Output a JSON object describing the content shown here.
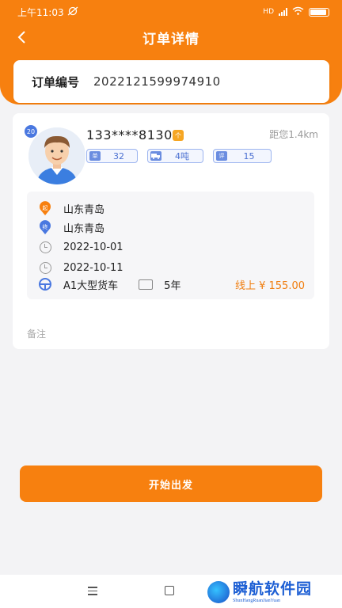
{
  "status_bar": {
    "time": "上午11:03",
    "signal_label": "HD"
  },
  "navbar": {
    "title": "订单详情"
  },
  "order": {
    "label": "订单编号",
    "number": "2022121599974910"
  },
  "driver": {
    "age_badge": "20",
    "phone": "133****8130",
    "vip_badge": "个",
    "distance": "距您1.4km",
    "tags": [
      {
        "icon_text": "单",
        "value": "32"
      },
      {
        "icon_text": "车",
        "value": "4吨"
      },
      {
        "icon_text": "评",
        "value": "15"
      }
    ]
  },
  "route": {
    "start_badge": "起",
    "end_badge": "终",
    "start": "山东青岛",
    "end": "山东青岛",
    "start_date": "2022-10-01",
    "end_date": "2022-10-11",
    "license_type": "A1大型货车",
    "experience": "5年",
    "price": "线上 ¥ 155.00"
  },
  "remark": {
    "label": "备注"
  },
  "actions": {
    "start_label": "开始出发"
  },
  "watermark": {
    "main": "瞬航软件园",
    "sub": "ShunHangRuanJianYuan"
  },
  "colors": {
    "primary": "#f7800f",
    "tag_blue": "#4a6fd1",
    "price": "#f07d0e"
  }
}
